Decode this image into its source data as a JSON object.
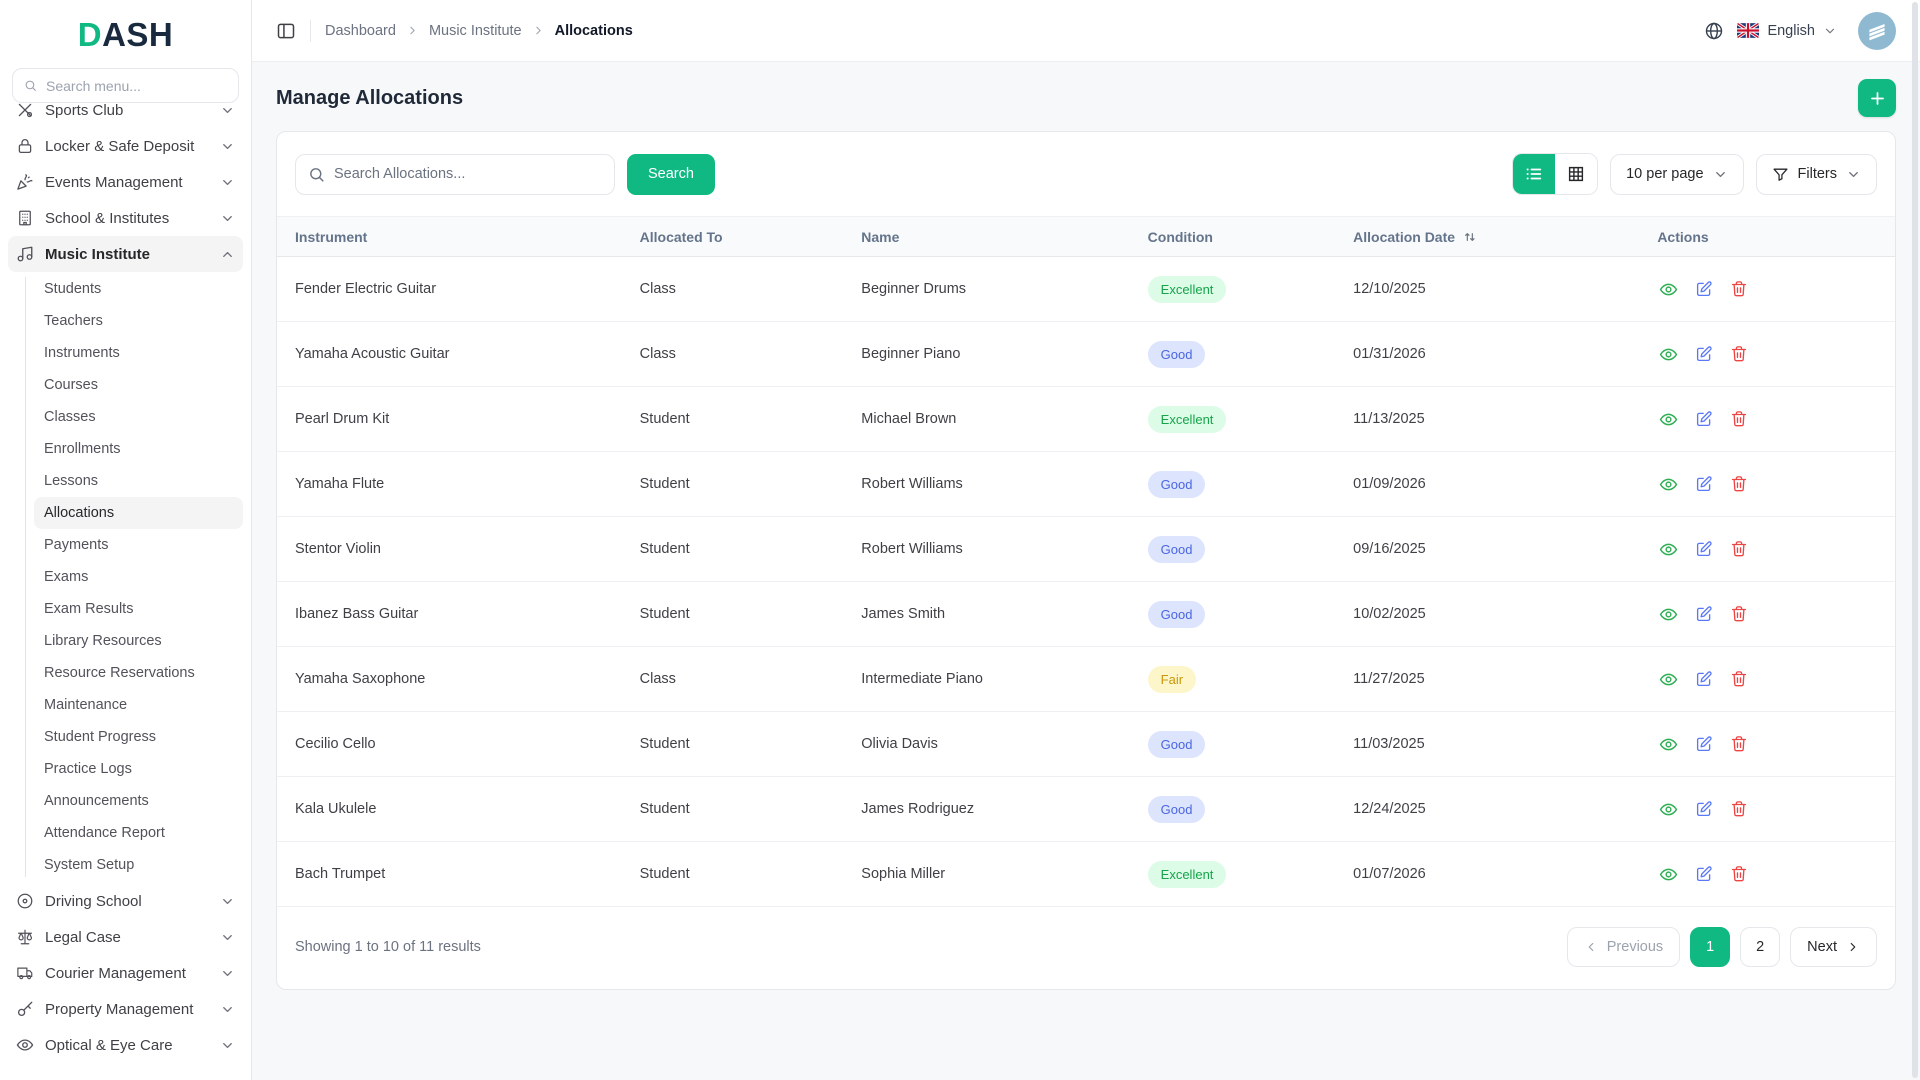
{
  "colors": {
    "accent": "#10b981",
    "logo-navy": "#192a3e",
    "border": "#e5e7eb",
    "page-bg": "#f7f8fa",
    "badge-excellent-bg": "#dcfce7",
    "badge-excellent-text": "#16a34a",
    "badge-good-bg": "#dde4fd",
    "badge-good-text": "#4a66e0",
    "badge-fair-bg": "#fdf6ca",
    "badge-fair-text": "#c9980a",
    "action-view": "#2fae54",
    "action-edit": "#5b78f6",
    "action-delete": "#ef4444"
  },
  "sidebar": {
    "logo": {
      "accent": "D",
      "rest": "ASH"
    },
    "search_placeholder": "Search menu...",
    "groups_top": [
      {
        "label": "Sports Club",
        "icon": "sports-icon"
      },
      {
        "label": "Locker & Safe Deposit",
        "icon": "lock-icon"
      },
      {
        "label": "Events Management",
        "icon": "party-popper-icon"
      },
      {
        "label": "School & Institutes",
        "icon": "building-icon"
      }
    ],
    "active_group": {
      "label": "Music Institute",
      "icon": "music-note-icon"
    },
    "sub_items": [
      {
        "label": "Students"
      },
      {
        "label": "Teachers"
      },
      {
        "label": "Instruments"
      },
      {
        "label": "Courses"
      },
      {
        "label": "Classes"
      },
      {
        "label": "Enrollments"
      },
      {
        "label": "Lessons"
      },
      {
        "label": "Allocations",
        "state": "active"
      },
      {
        "label": "Payments"
      },
      {
        "label": "Exams"
      },
      {
        "label": "Exam Results"
      },
      {
        "label": "Library Resources"
      },
      {
        "label": "Resource Reservations"
      },
      {
        "label": "Maintenance"
      },
      {
        "label": "Student Progress"
      },
      {
        "label": "Practice Logs"
      },
      {
        "label": "Announcements"
      },
      {
        "label": "Attendance Report"
      },
      {
        "label": "System Setup"
      }
    ],
    "groups_bottom": [
      {
        "label": "Driving School",
        "icon": "steering-wheel-icon"
      },
      {
        "label": "Legal Case",
        "icon": "scales-icon"
      },
      {
        "label": "Courier Management",
        "icon": "truck-icon"
      },
      {
        "label": "Property Management",
        "icon": "key-icon"
      },
      {
        "label": "Optical & Eye Care",
        "icon": "eye-icon"
      }
    ]
  },
  "header": {
    "breadcrumb": [
      {
        "label": "Dashboard"
      },
      {
        "label": "Music Institute"
      },
      {
        "label": "Allocations"
      }
    ],
    "language": "English",
    "icons": [
      "panel-left-icon",
      "globe-icon",
      "uk-flag-icon",
      "chevron-down-icon",
      "avatar"
    ]
  },
  "page": {
    "title": "Manage Allocations",
    "add_button_icon": "plus-icon"
  },
  "toolbar": {
    "search_placeholder": "Search Allocations...",
    "search_button": "Search",
    "view_modes": [
      {
        "icon": "list-view-icon",
        "state": "active"
      },
      {
        "icon": "grid-view-icon"
      }
    ],
    "per_page": "10 per page",
    "filters": "Filters"
  },
  "table": {
    "columns": [
      {
        "label": "Instrument"
      },
      {
        "label": "Allocated To"
      },
      {
        "label": "Name"
      },
      {
        "label": "Condition"
      },
      {
        "label": "Allocation Date",
        "state": "sortable"
      },
      {
        "label": "Actions"
      }
    ],
    "row_action_icons": [
      "eye-icon",
      "edit-pencil-icon",
      "trash-icon"
    ],
    "rows": [
      {
        "instrument": "Fender Electric Guitar",
        "allocated_to": "Class",
        "name": "Beginner Drums",
        "condition": "Excellent",
        "date": "12/10/2025"
      },
      {
        "instrument": "Yamaha Acoustic Guitar",
        "allocated_to": "Class",
        "name": "Beginner Piano",
        "condition": "Good",
        "date": "01/31/2026"
      },
      {
        "instrument": "Pearl Drum Kit",
        "allocated_to": "Student",
        "name": "Michael Brown",
        "condition": "Excellent",
        "date": "11/13/2025"
      },
      {
        "instrument": "Yamaha Flute",
        "allocated_to": "Student",
        "name": "Robert Williams",
        "condition": "Good",
        "date": "01/09/2026"
      },
      {
        "instrument": "Stentor Violin",
        "allocated_to": "Student",
        "name": "Robert Williams",
        "condition": "Good",
        "date": "09/16/2025"
      },
      {
        "instrument": "Ibanez Bass Guitar",
        "allocated_to": "Student",
        "name": "James Smith",
        "condition": "Good",
        "date": "10/02/2025"
      },
      {
        "instrument": "Yamaha Saxophone",
        "allocated_to": "Class",
        "name": "Intermediate Piano",
        "condition": "Fair",
        "date": "11/27/2025"
      },
      {
        "instrument": "Cecilio Cello",
        "allocated_to": "Student",
        "name": "Olivia Davis",
        "condition": "Good",
        "date": "11/03/2025"
      },
      {
        "instrument": "Kala Ukulele",
        "allocated_to": "Student",
        "name": "James Rodriguez",
        "condition": "Good",
        "date": "12/24/2025"
      },
      {
        "instrument": "Bach Trumpet",
        "allocated_to": "Student",
        "name": "Sophia Miller",
        "condition": "Excellent",
        "date": "01/07/2026"
      }
    ]
  },
  "pagination": {
    "showing": "Showing 1 to 10 of 11 results",
    "previous": "Previous",
    "next": "Next",
    "pages": [
      {
        "label": "1",
        "state": "active"
      },
      {
        "label": "2"
      }
    ]
  }
}
